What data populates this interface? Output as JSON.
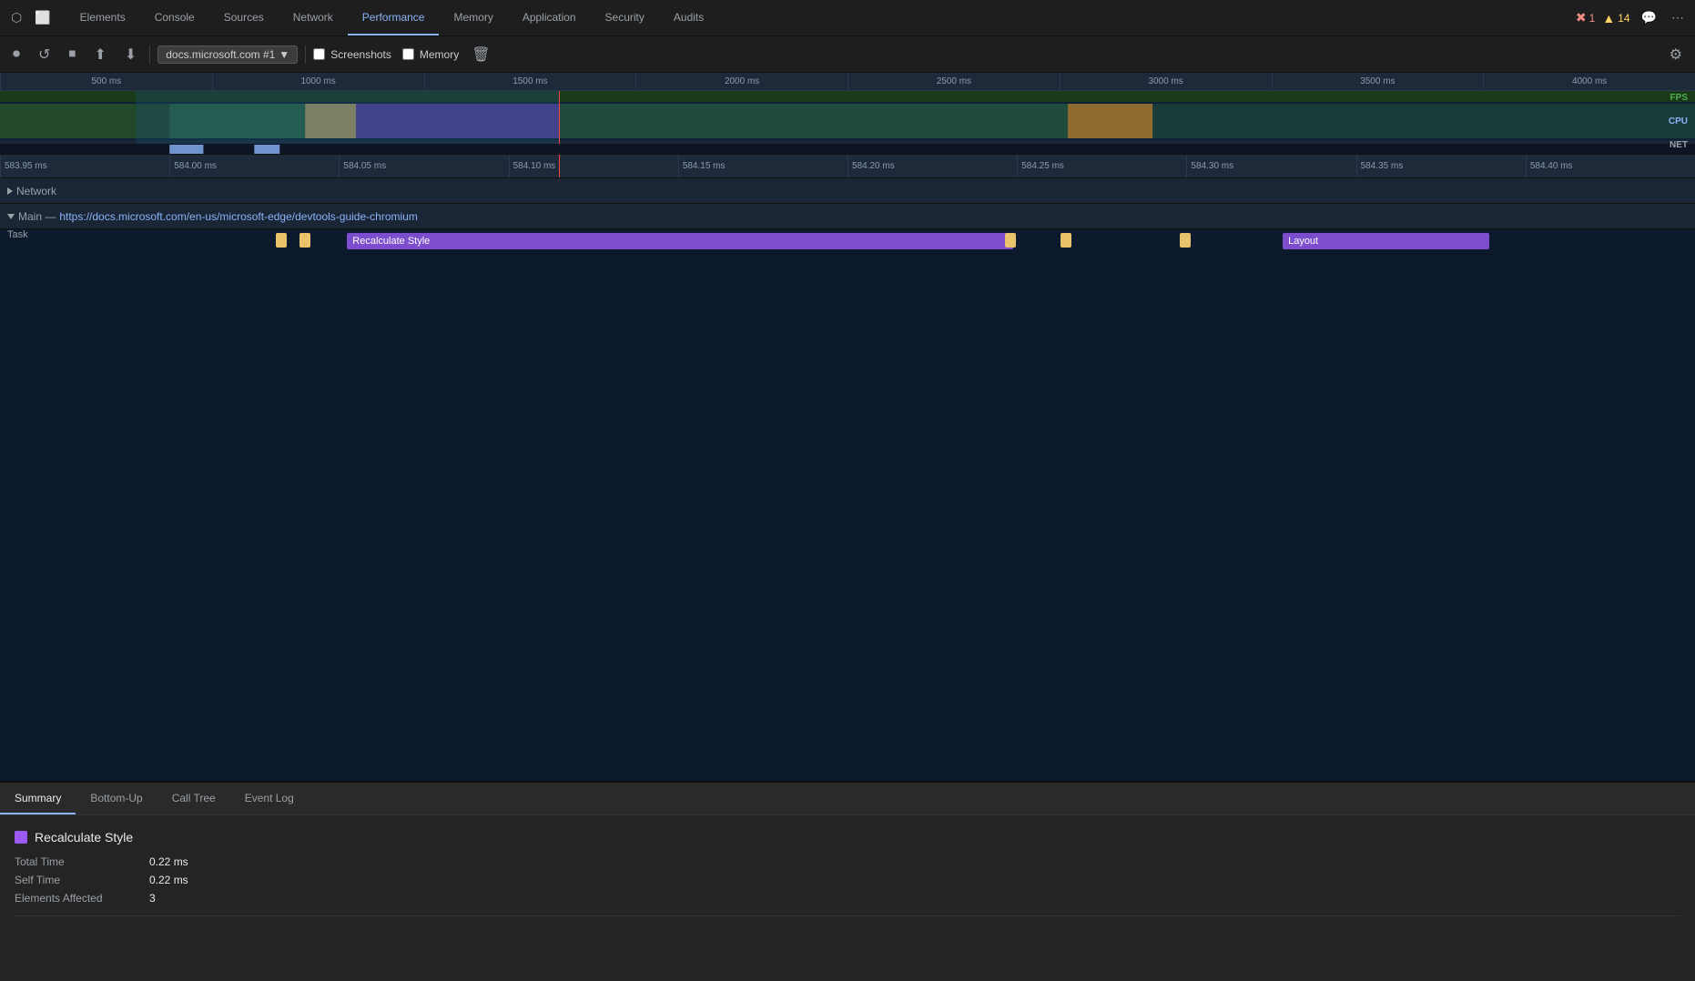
{
  "topNav": {
    "tabs": [
      {
        "id": "elements",
        "label": "Elements",
        "active": false
      },
      {
        "id": "console",
        "label": "Console",
        "active": false
      },
      {
        "id": "sources",
        "label": "Sources",
        "active": false
      },
      {
        "id": "network",
        "label": "Network",
        "active": false
      },
      {
        "id": "performance",
        "label": "Performance",
        "active": true
      },
      {
        "id": "memory",
        "label": "Memory",
        "active": false
      },
      {
        "id": "application",
        "label": "Application",
        "active": false
      },
      {
        "id": "security",
        "label": "Security",
        "active": false
      },
      {
        "id": "audits",
        "label": "Audits",
        "active": false
      }
    ],
    "errorCount": "1",
    "warnCount": "14"
  },
  "toolbar": {
    "record_tooltip": "Record",
    "reload_tooltip": "Reload and profile page",
    "stop_tooltip": "Stop recording",
    "upload_tooltip": "Load profile",
    "download_tooltip": "Save profile",
    "profileSelector": "docs.microsoft.com #1",
    "screenshots_label": "Screenshots",
    "memory_label": "Memory",
    "trash_tooltip": "Clear recording",
    "settings_tooltip": "Capture settings"
  },
  "overview": {
    "ruler_marks": [
      "500 ms",
      "1000 ms",
      "1500 ms",
      "2000 ms",
      "2500 ms",
      "3000 ms",
      "3500 ms",
      "4000 ms"
    ],
    "labels": {
      "fps": "FPS",
      "cpu": "CPU",
      "net": "NET"
    }
  },
  "detailRuler": {
    "marks": [
      "583.95 ms",
      "584.00 ms",
      "584.05 ms",
      "584.10 ms",
      "584.15 ms",
      "584.20 ms",
      "584.25 ms",
      "584.30 ms",
      "584.35 ms",
      "584.40 ms"
    ]
  },
  "networkRow": {
    "label": "Network",
    "expanded": false
  },
  "mainThread": {
    "label": "Main",
    "url": "https://docs.microsoft.com/en-us/microsoft-edge/devtools-guide-chromium",
    "expanded": true
  },
  "taskRow": {
    "label": "Task"
  },
  "flameBars": [
    {
      "id": "recalculate-style",
      "label": "Recalculate Style",
      "color": "purple",
      "left": "15%",
      "width": "40%"
    },
    {
      "id": "layout",
      "label": "Layout",
      "color": "purple",
      "left": "74%",
      "width": "13%"
    },
    {
      "id": "yellow1",
      "label": "",
      "color": "yellow",
      "left": "10.5%",
      "width": "0.7%"
    },
    {
      "id": "yellow2",
      "label": "",
      "color": "yellow",
      "left": "12%",
      "width": "0.7%"
    },
    {
      "id": "yellow3",
      "label": "",
      "color": "yellow",
      "left": "56.5%",
      "width": "0.7%"
    },
    {
      "id": "yellow4",
      "label": "",
      "color": "yellow",
      "left": "60%",
      "width": "0.7%"
    },
    {
      "id": "yellow5",
      "label": "",
      "color": "yellow",
      "left": "68%",
      "width": "0.7%"
    }
  ],
  "bottomPanel": {
    "tabs": [
      {
        "id": "summary",
        "label": "Summary",
        "active": true
      },
      {
        "id": "bottom-up",
        "label": "Bottom-Up",
        "active": false
      },
      {
        "id": "call-tree",
        "label": "Call Tree",
        "active": false
      },
      {
        "id": "event-log",
        "label": "Event Log",
        "active": false
      }
    ],
    "summary": {
      "title": "Recalculate Style",
      "color": "#9b59f5",
      "stats": [
        {
          "label": "Total Time",
          "value": "0.22 ms"
        },
        {
          "label": "Self Time",
          "value": "0.22 ms"
        },
        {
          "label": "Elements Affected",
          "value": "3"
        }
      ]
    }
  }
}
